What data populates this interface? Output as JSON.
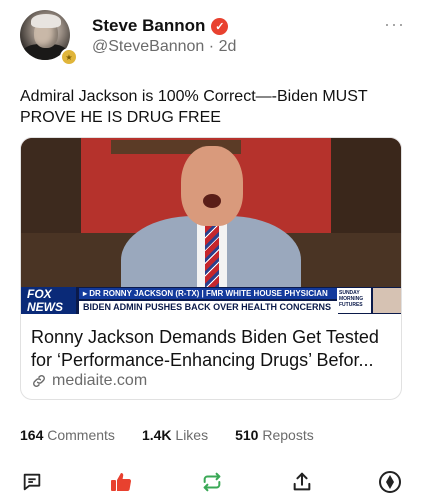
{
  "post": {
    "author_name": "Steve Bannon",
    "handle": "@SteveBannon",
    "separator": "·",
    "age": "2d",
    "more_label": "···",
    "text": "Admiral Jackson is 100% Correct—-Biden MUST PROVE HE IS DRUG FREE"
  },
  "link_card": {
    "title": "Ronny Jackson Demands Biden Get Tested for ‘Performance-Enhancing Drugs’ Befor...",
    "domain": "mediaite.com",
    "thumbnail": {
      "network_logo": "FOX NEWS",
      "chyron_top": "▸ DR RONNY JACKSON (R-TX) | FMR WHITE HOUSE PHYSICIAN",
      "chyron_headline": "BIDEN ADMIN PUSHES BACK OVER HEALTH CONCERNS",
      "show_name": "SUNDAY MORNING FUTURES"
    }
  },
  "stats": {
    "comments_count": "164",
    "comments_label": "Comments",
    "likes_count": "1.4K",
    "likes_label": "Likes",
    "reposts_count": "510",
    "reposts_label": "Reposts"
  },
  "colors": {
    "verified_badge": "#e8412f",
    "like_active": "#e8412f",
    "repost_icon": "#3aa856",
    "muted_text": "#6b6b6b"
  },
  "icons": {
    "comment": "comment-icon",
    "like": "thumbs-up-icon",
    "repost": "repost-icon",
    "share": "share-icon",
    "boost": "boost-icon"
  }
}
